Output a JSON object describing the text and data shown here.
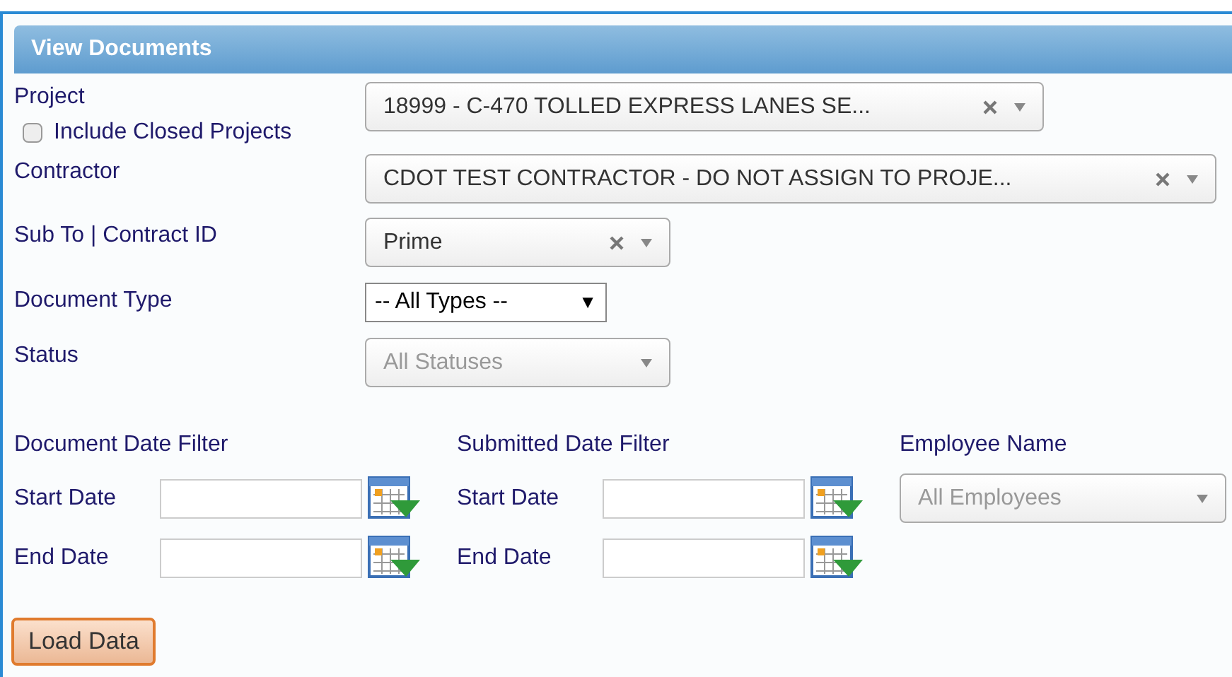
{
  "panel": {
    "title": "View Documents"
  },
  "fields": [
    {
      "kind": "combo",
      "label": "Project",
      "checkbox": {
        "label": "Include Closed Projects",
        "checked": false
      },
      "value": "18999 - C-470 TOLLED EXPRESS LANES SE...",
      "clearable": true,
      "disabled": false
    },
    {
      "kind": "combo",
      "label": "Contractor",
      "value": "CDOT TEST CONTRACTOR - DO NOT ASSIGN TO PROJE...",
      "clearable": true,
      "disabled": false
    },
    {
      "kind": "combo",
      "label": "Sub To | Contract ID",
      "value": "Prime",
      "clearable": true,
      "disabled": false
    },
    {
      "kind": "native",
      "label": "Document Type",
      "value": "-- All Types --",
      "arrow": "▼"
    },
    {
      "kind": "combo",
      "label": "Status",
      "value": "All Statuses",
      "clearable": false,
      "disabled": true
    }
  ],
  "date_filters": [
    {
      "title": "Document Date Filter",
      "rows": [
        {
          "label": "Start Date"
        },
        {
          "label": "End Date"
        }
      ]
    },
    {
      "title": "Submitted Date Filter",
      "rows": [
        {
          "label": "Start Date"
        },
        {
          "label": "End Date"
        }
      ]
    }
  ],
  "employee": {
    "label": "Employee Name",
    "value": "All Employees",
    "disabled": true
  },
  "buttons": [
    {
      "label": "Load Data"
    }
  ]
}
